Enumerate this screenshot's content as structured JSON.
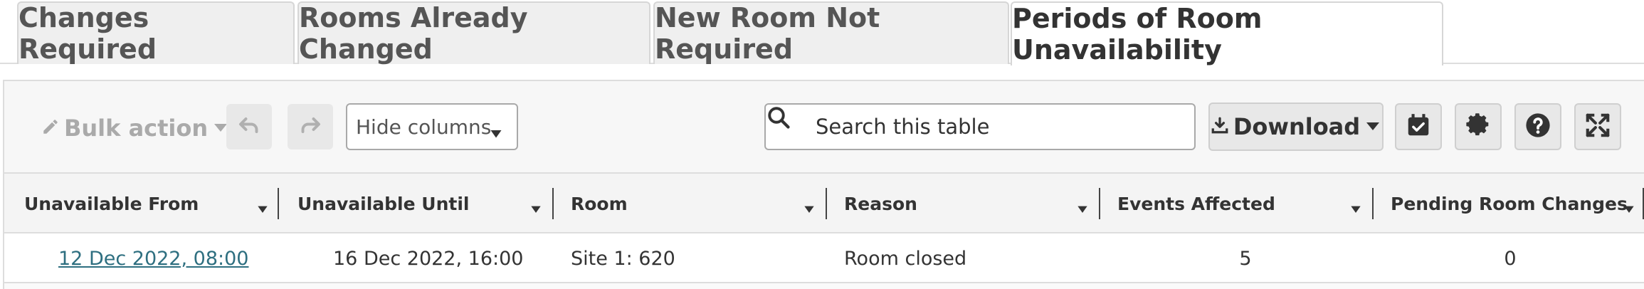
{
  "tabs": [
    {
      "label": "Changes Required",
      "active": false
    },
    {
      "label": "Rooms Already Changed",
      "active": false
    },
    {
      "label": "New Room Not Required",
      "active": false
    },
    {
      "label": "Periods of Room Unavailability",
      "active": true
    }
  ],
  "toolbar": {
    "bulk_action_label": "Bulk action",
    "hide_columns_label": "Hide columns",
    "search_placeholder": "Search this table",
    "download_label": "Download",
    "icons": [
      "pencil-icon",
      "undo-icon",
      "redo-icon",
      "search-icon",
      "download-icon",
      "calendar-check-icon",
      "gear-icon",
      "help-icon",
      "fullscreen-icon"
    ]
  },
  "table": {
    "columns": [
      "Unavailable From",
      "Unavailable Until",
      "Room",
      "Reason",
      "Events Affected",
      "Pending Room Changes"
    ],
    "rows": [
      {
        "unavailable_from": "12 Dec 2022, 08:00",
        "unavailable_until": "16 Dec 2022, 16:00",
        "room": "Site 1: 620",
        "reason": "Room closed",
        "events_affected": "5",
        "pending_room_changes": "0"
      }
    ]
  },
  "colors": {
    "link": "#2e6f80",
    "tab_inactive_bg": "#efefef",
    "button_bg": "#e8e8e8",
    "border": "#dddddd"
  }
}
